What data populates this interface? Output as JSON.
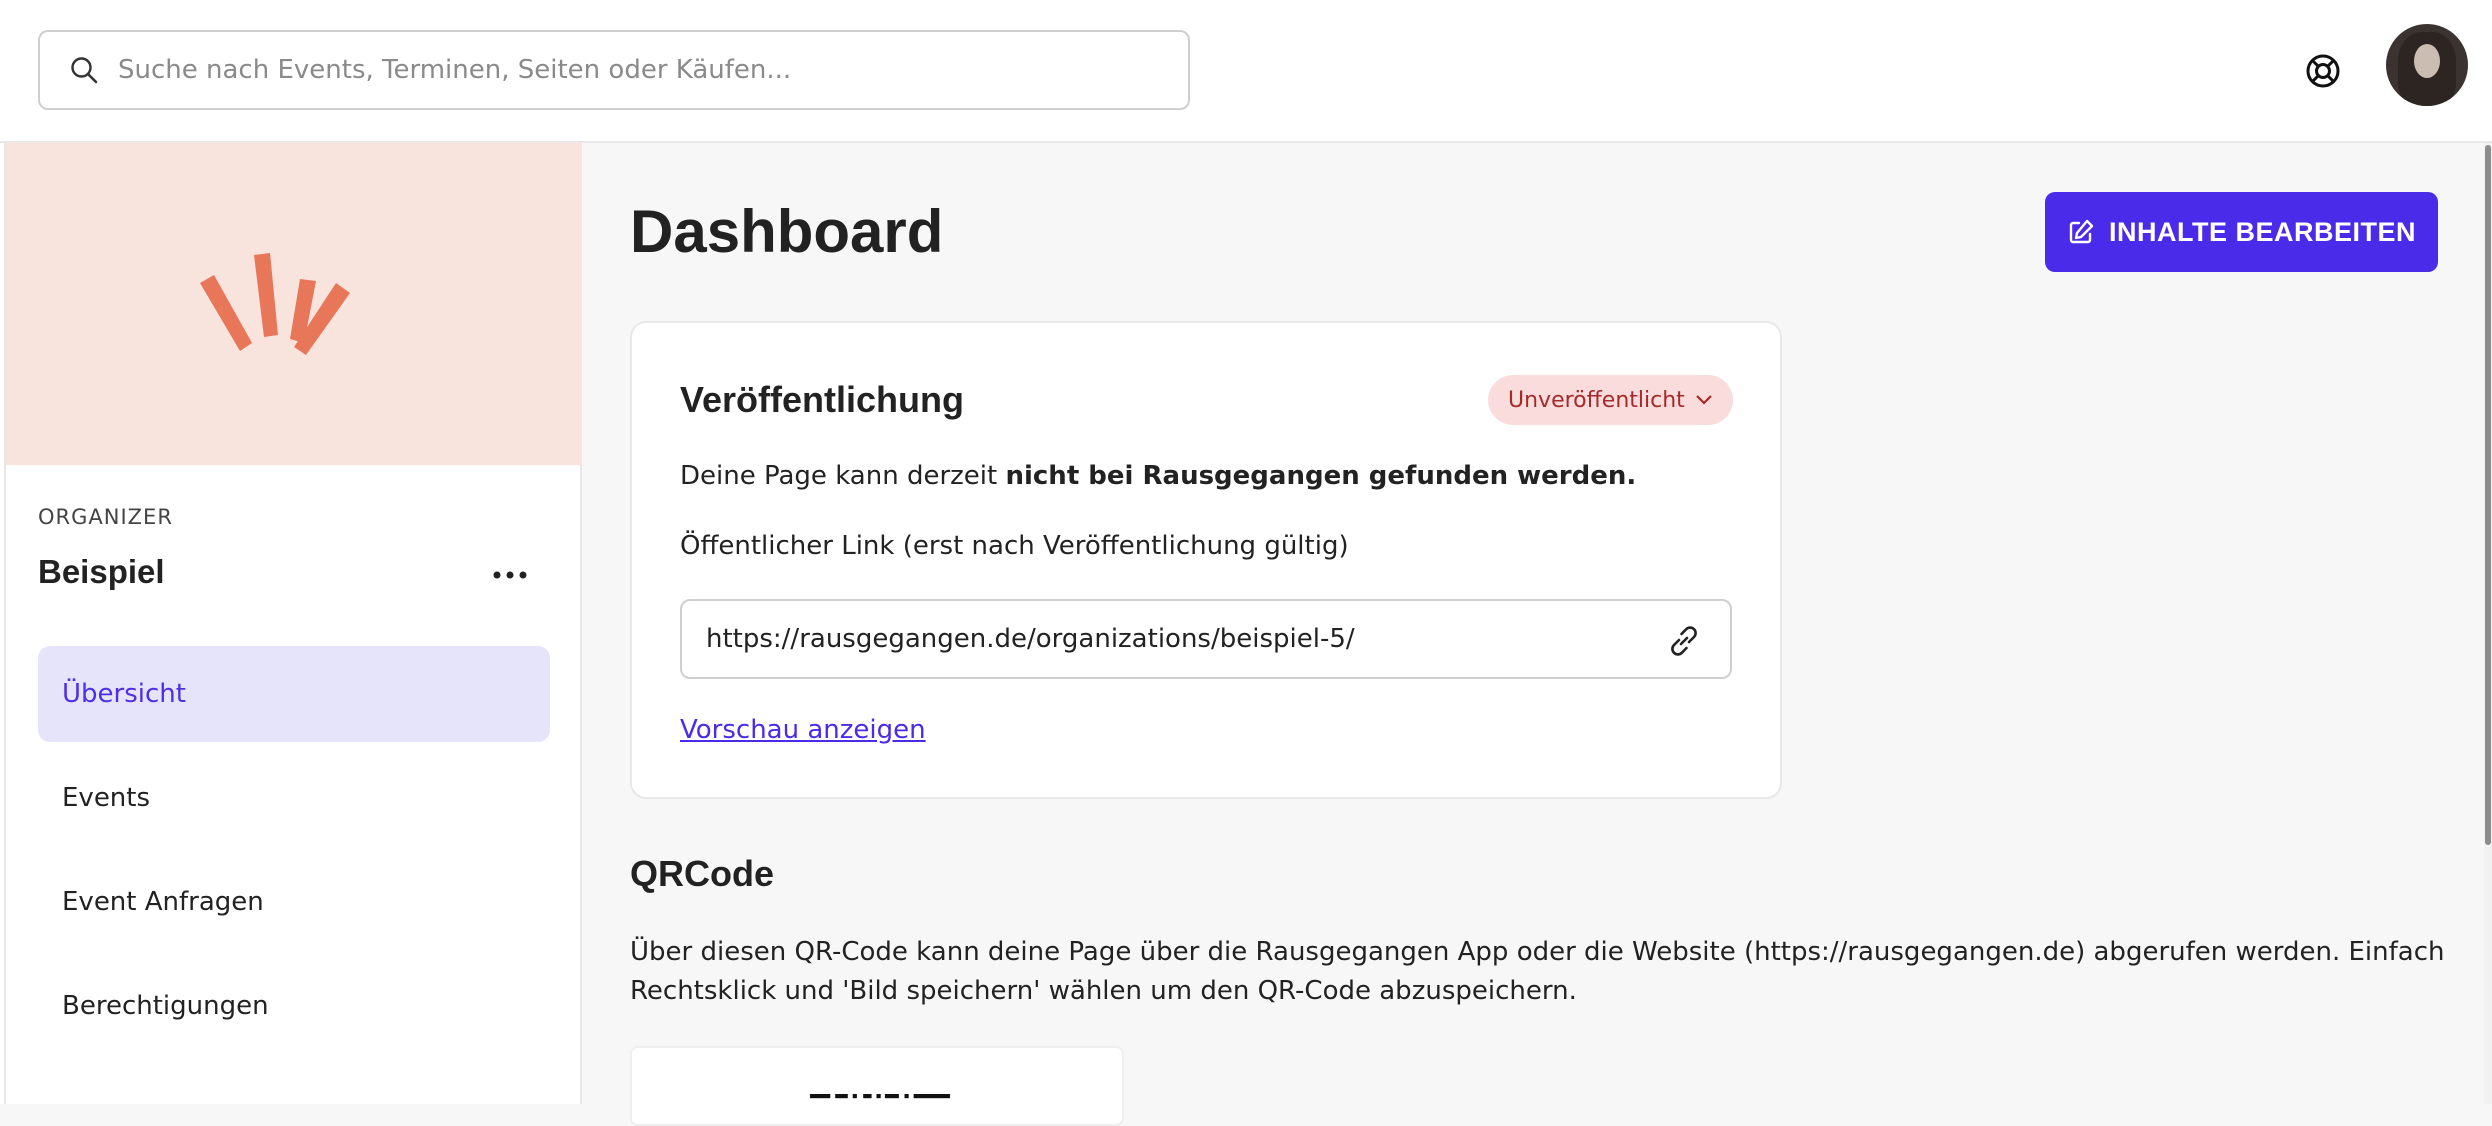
{
  "search": {
    "placeholder": "Suche nach Events, Terminen, Seiten oder Käufen..."
  },
  "header": {
    "help_icon": "lifebuoy-icon",
    "avatar": "user-avatar"
  },
  "sidebar": {
    "org_label": "ORGANIZER",
    "org_name": "Beispiel",
    "more_icon": "more-horizontal-icon",
    "items": [
      {
        "label": "Übersicht",
        "active": true
      },
      {
        "label": "Events",
        "active": false
      },
      {
        "label": "Event Anfragen",
        "active": false
      },
      {
        "label": "Berechtigungen",
        "active": false
      }
    ]
  },
  "main": {
    "title": "Dashboard",
    "edit_button": "INHALTE BEARBEITEN",
    "publication": {
      "title": "Veröffentlichung",
      "status": "Unveröffentlicht",
      "text_prefix": "Deine Page kann derzeit ",
      "text_bold": "nicht bei Rausgegangen gefunden werden.",
      "link_label": "Öffentlicher Link (erst nach Veröffentlichung gültig)",
      "link_value": "https://rausgegangen.de/organizations/beispiel-5/",
      "preview_link": "Vorschau anzeigen"
    },
    "qrcode": {
      "title": "QRCode",
      "description": "Über diesen QR-Code kann deine Page über die Rausgegangen App oder die Website (https://rausgegangen.de) abgerufen werden. Einfach Rechtsklick und 'Bild speichern' wählen um den QR-Code abzuspeichern."
    }
  },
  "colors": {
    "accent": "#4a2bea",
    "active_nav_bg": "#e6e4fb",
    "banner_bg": "#f9e3dd",
    "logo": "#e8775a",
    "badge_bg": "#fadcdc",
    "badge_text": "#a32b2b"
  }
}
